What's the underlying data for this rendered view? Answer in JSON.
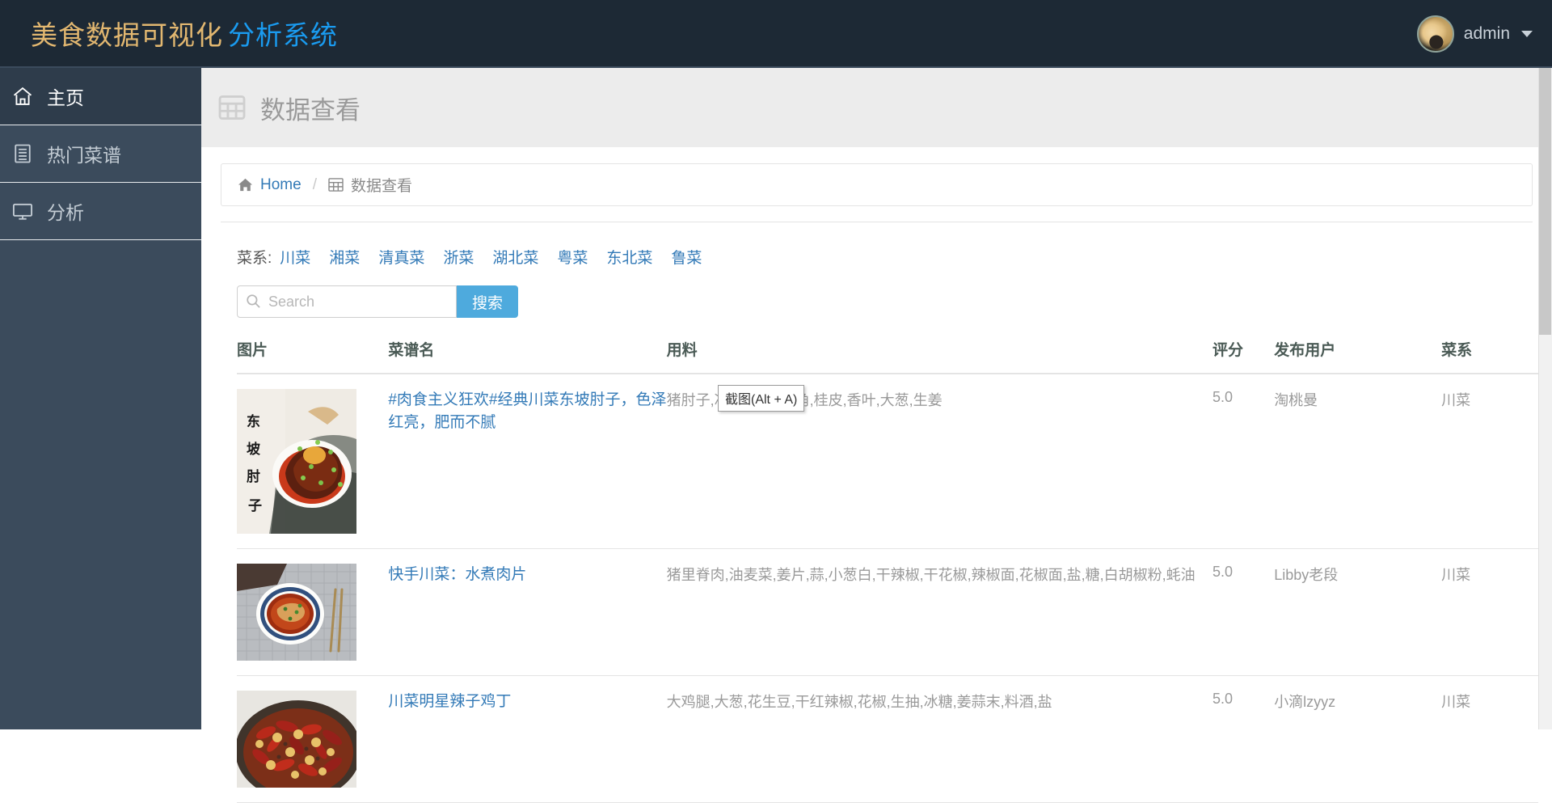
{
  "navbar": {
    "brand_main": "美食数据可视化",
    "brand_sub": "分析系统",
    "user_name": "admin",
    "avatar_icon": "user-avatar",
    "caret_icon": "chevron-down-icon",
    "bg_color": "#1d2935",
    "brand_main_color": "#e2b770",
    "brand_sub_color": "#1a9bf0"
  },
  "sidebar": {
    "bg_color": "#3b4b5c",
    "items": [
      {
        "label": "主页",
        "icon": "home-icon",
        "active": true
      },
      {
        "label": "热门菜谱",
        "icon": "list-document-icon",
        "active": false
      },
      {
        "label": "分析",
        "icon": "monitor-icon",
        "active": false
      }
    ]
  },
  "page": {
    "title": "数据查看",
    "title_icon": "table-grid-icon"
  },
  "breadcrumb": {
    "home_icon": "home-solid-icon",
    "home_label": "Home",
    "separator": "/",
    "current_icon": "table-grid-icon",
    "current_label": "数据查看"
  },
  "filter": {
    "label": "菜系:",
    "links": [
      "川菜",
      "湘菜",
      "清真菜",
      "浙菜",
      "湖北菜",
      "粤菜",
      "东北菜",
      "鲁菜"
    ]
  },
  "search": {
    "placeholder": "Search",
    "value": "",
    "icon": "search-icon",
    "button_label": "搜索",
    "button_color": "#4eaadd"
  },
  "table": {
    "headers": [
      "图片",
      "菜谱名",
      "用料",
      "评分",
      "发布用户",
      "菜系"
    ],
    "rows": [
      {
        "image_alt": "东坡肘子",
        "name": "#肉食主义狂欢#经典川菜东坡肘子，色泽红亮，肥而不腻",
        "ingredients": "猪肘子,冰糖,黄酒,八角,桂皮,香叶,大葱,生姜",
        "score": "5.0",
        "user": "淘桃曼",
        "cuisine": "川菜"
      },
      {
        "image_alt": "水煮肉片",
        "name": "快手川菜：水煮肉片",
        "ingredients": "猪里脊肉,油麦菜,姜片,蒜,小葱白,干辣椒,干花椒,辣椒面,花椒面,盐,糖,白胡椒粉,蚝油",
        "score": "5.0",
        "user": "Libby老段",
        "cuisine": "川菜"
      },
      {
        "image_alt": "辣子鸡丁",
        "name": "川菜明星辣子鸡丁",
        "ingredients": "大鸡腿,大葱,花生豆,干红辣椒,花椒,生抽,冰糖,姜蒜末,料酒,盐",
        "score": "5.0",
        "user": "小滴lzyyz",
        "cuisine": "川菜"
      }
    ]
  },
  "tooltip": {
    "text": "截图(Alt + A)"
  }
}
